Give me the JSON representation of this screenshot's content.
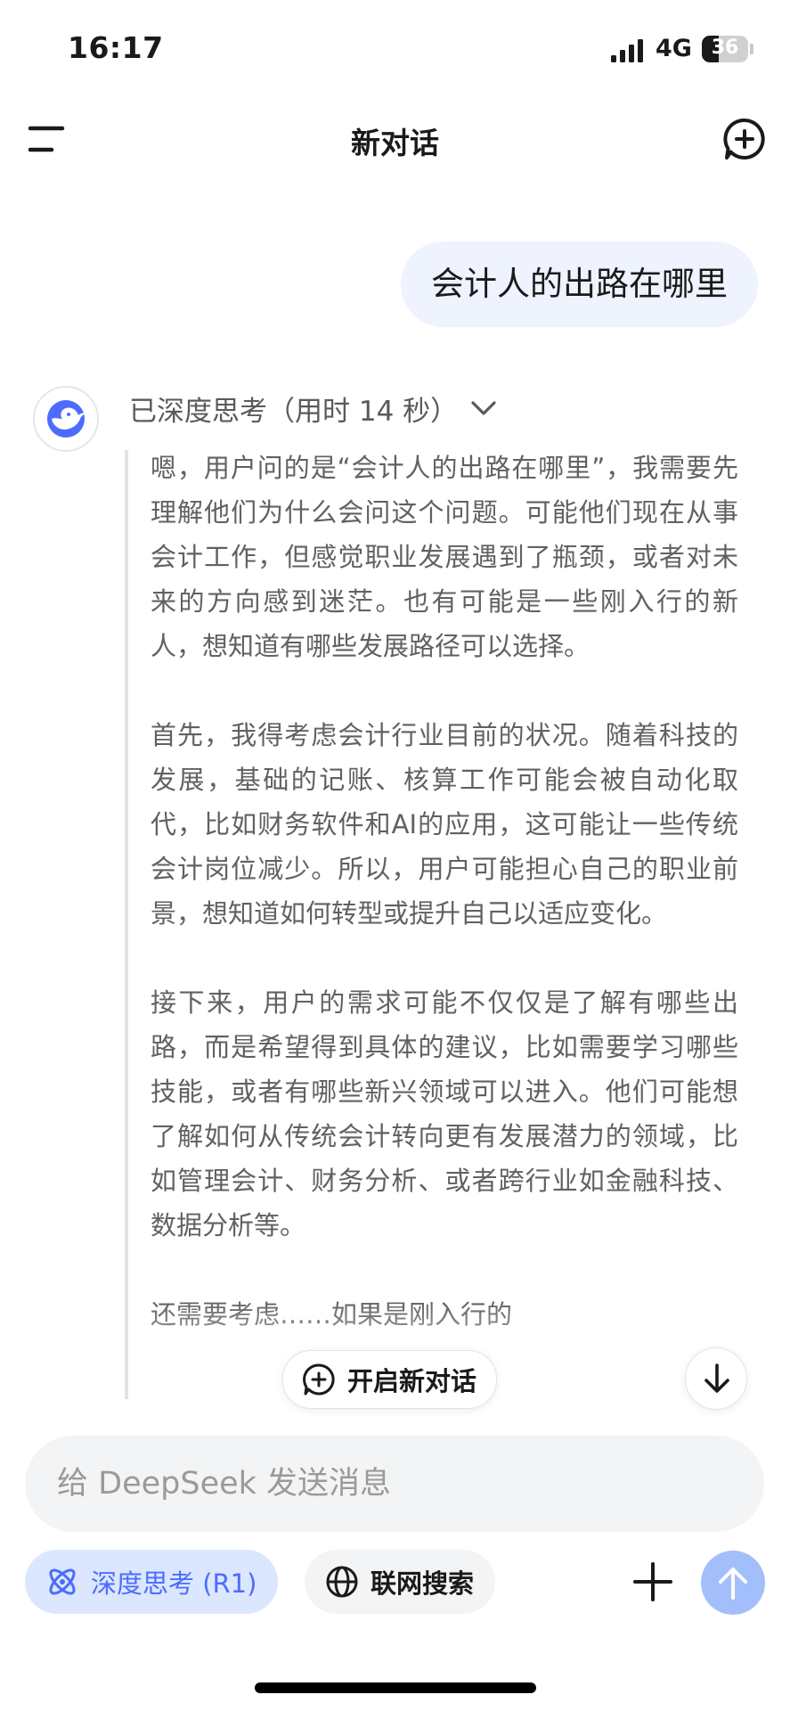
{
  "status_bar": {
    "time": "16:17",
    "network": "4G",
    "battery": "36",
    "battery_level": 0.36
  },
  "header": {
    "title": "新对话",
    "menu_icon": "menu-icon",
    "new_chat_icon": "new-chat-icon"
  },
  "user_message": "会计人的出路在哪里",
  "assistant": {
    "avatar_icon": "whale-logo-icon",
    "thinking_label": "已深度思考（用时 14 秒）",
    "thinking_paragraphs": [
      "嗯，用户问的是“会计人的出路在哪里”，我需要先理解他们为什么会问这个问题。可能他们现在从事会计工作，但感觉职业发展遇到了瓶颈，或者对未来的方向感到迷茫。也有可能是一些刚入行的新人，想知道有哪些发展路径可以选择。",
      "首先，我得考虑会计行业目前的状况。随着科技的发展，基础的记账、核算工作可能会被自动化取代，比如财务软件和AI的应用，这可能让一些传统会计岗位减少。所以，用户可能担心自己的职业前景，想知道如何转型或提升自己以适应变化。",
      "接下来，用户的需求可能不仅仅是了解有哪些出路，而是希望得到具体的建议，比如需要学习哪些技能，或者有哪些新兴领域可以进入。他们可能想了解如何从传统会计转向更有发展潜力的领域，比如管理会计、财务分析、或者跨行业如金融科技、数据分析等。",
      "还需要考虑……如果是刚入行的"
    ]
  },
  "floating": {
    "new_chat_label": "开启新对话",
    "scroll_down_icon": "arrow-down-icon"
  },
  "input": {
    "placeholder": "给 DeepSeek 发送消息"
  },
  "toolbar": {
    "deep_think_label": "深度思考 (R1)",
    "web_search_label": "联网搜索",
    "plus_icon": "plus-icon",
    "send_icon": "send-arrow-icon"
  },
  "colors": {
    "accent": "#4d6bfe",
    "user_bubble": "#eef3fe",
    "deep_think_bg": "#dbe7fe",
    "send_disabled": "#a3bffb",
    "thinking_text": "#616161"
  }
}
